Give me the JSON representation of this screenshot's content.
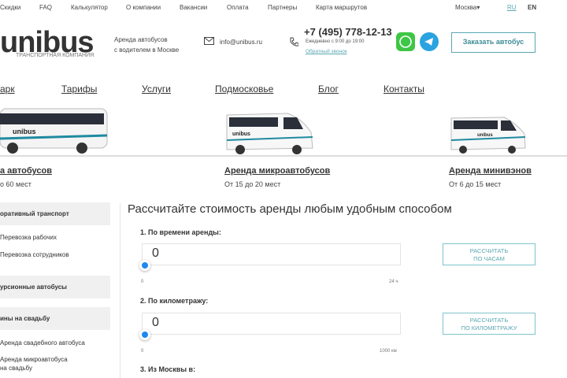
{
  "topbar": {
    "links": [
      "Скидки",
      "FAQ",
      "Калькулятор",
      "О компании",
      "Вакансии",
      "Оплата",
      "Партнеры",
      "Карта маршрутов"
    ],
    "city": "Москва",
    "lang_ru": "RU",
    "lang_en": "EN"
  },
  "header": {
    "logo": "unibus",
    "logo_sub": "ТРАНСПОРТНАЯ КОМПАНИЯ",
    "tagline_1": "Аренда автобусов",
    "tagline_2": "с водителем в Москве",
    "email": "info@unibus.ru",
    "phone": "+7 (495) 778-12-13",
    "hours": "Ежедневно с 9:00 до 19:00",
    "callback": "Обратный звонок",
    "order_button": "Заказать автобус"
  },
  "nav": [
    "арк",
    "Тарифы",
    "Услуги",
    "Подмосковье",
    "Блог",
    "Контакты"
  ],
  "vehicles": [
    {
      "title": "а автобусов",
      "sub": "о 60 мест",
      "label": "unibus"
    },
    {
      "title": "Аренда микроавтобусов",
      "sub": "От 15 до 20 мест",
      "label": "unibus"
    },
    {
      "title": "Аренда минивэнов",
      "sub": "От 6 до 15 мест",
      "label": "unibus"
    }
  ],
  "sidebar": {
    "h1": "оративный транспорт",
    "i1": "Перевозка рабочих",
    "i2": "Перевозка сотрудников",
    "h2": "урсионные автобусы",
    "h3": "ины на свадьбу",
    "i3": "Аренда свадебного автобуса",
    "i4a": "Аренда микроавтобуса",
    "i4b": "на свадьбу"
  },
  "calc": {
    "title": "Рассчитайте стоимость аренды любым удобным способом",
    "s1": "1. По времени аренды:",
    "v1": "0",
    "min1": "0",
    "max1": "24 ч",
    "b1a": "РАССЧИТАТЬ",
    "b1b": "ПО ЧАСАМ",
    "s2": "2. По километражу:",
    "v2": "0",
    "min2": "0",
    "max2": "1000 км",
    "b2a": "РАССЧИТАТЬ",
    "b2b": "ПО КИЛОМЕТРАЖУ",
    "s3": "3. Из Москвы в:",
    "progress_hours": 0,
    "progress_km": 0
  },
  "colors": {
    "accent": "#5aa7b2",
    "slider": "#1e88f0",
    "whatsapp": "#3ec646",
    "telegram": "#2aa3e0"
  }
}
